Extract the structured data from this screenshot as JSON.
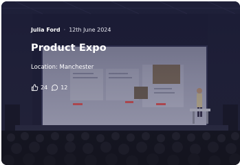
{
  "post": {
    "author": "Julia Ford",
    "separator": "·",
    "date": "12th June 2024",
    "title": "Product Expo",
    "location": "Location: Manchester",
    "likes": "24",
    "comments": "12"
  },
  "icons": {
    "like": "thumbs-up-icon",
    "comment": "speech-bubble-icon"
  },
  "colors": {
    "overlay": "#14163a",
    "text": "#ffffff"
  }
}
